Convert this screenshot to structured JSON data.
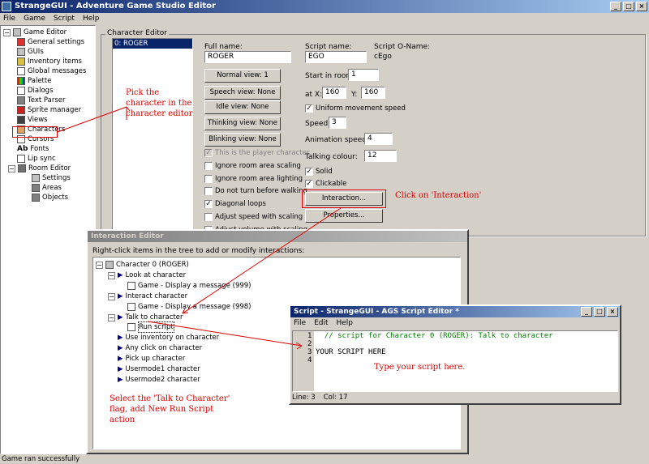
{
  "app": {
    "title": "StrangeGUI - Adventure Game Studio Editor",
    "window_buttons": [
      "_",
      "□",
      "×"
    ]
  },
  "menu": [
    "File",
    "Game",
    "Script",
    "Help"
  ],
  "tree": {
    "root": "Game Editor",
    "items": [
      "General settings",
      "GUIs",
      "Inventory items",
      "Global messages",
      "Palette",
      "Dialogs",
      "Text Parser",
      "Sprite manager",
      "Views",
      "Characters",
      "Cursors",
      "Fonts",
      "Lip sync",
      "Room Editor"
    ],
    "room_items": [
      "Settings",
      "Areas",
      "Objects"
    ]
  },
  "char_editor": {
    "group_title": "Character Editor",
    "list_items": [
      "0: ROGER"
    ],
    "full_name_label": "Full name:",
    "full_name": "ROGER",
    "script_name_label": "Script name:",
    "script_name": "EGO",
    "script_oname_label": "Script O-Name:",
    "script_oname": "cEgo",
    "start_room_label": "Start in room",
    "start_room": "1",
    "at_x_label": "at X:",
    "at_x": "160",
    "y_label": "Y:",
    "y": "160",
    "buttons": [
      "Normal view: 1",
      "Speech view: None",
      "Idle view: None",
      "Thinking view: None",
      "Blinking view: None"
    ],
    "uniform_label": "Uniform movement speed",
    "speed_label": "Speed:",
    "speed": "3",
    "anim_label": "Animation speed:",
    "anim": "4",
    "talk_colour_label": "Talking colour:",
    "talk_colour": "12",
    "solid_label": "Solid",
    "clickable_label": "Clickable",
    "interaction_btn": "Interaction...",
    "properties_btn": "Properties...",
    "checks": [
      "This is the player character",
      "Ignore room area scaling",
      "Ignore room area lighting",
      "Do not turn before walking",
      "Diagonal loops",
      "Adjust speed with scaling",
      "Adjust volume with scaling"
    ]
  },
  "annotations": {
    "pick": "Pick the character in the character editor",
    "click": "Click on 'Interaction'",
    "select": "Select the 'Talk to Character' flag, add New Run Script action",
    "type": "Type your script here."
  },
  "interaction_editor": {
    "title": "Interaction Editor",
    "hint": "Right-click items in the tree to add or modify interactions:",
    "root": "Character 0 (ROGER)",
    "events": [
      {
        "label": "Look at character",
        "child": "Game - Display a message (999)"
      },
      {
        "label": "Interact character",
        "child": "Game - Display a message (998)"
      },
      {
        "label": "Talk to character",
        "child": "Run script"
      },
      {
        "label": "Use inventory on character",
        "child": ""
      },
      {
        "label": "Any click on character",
        "child": ""
      },
      {
        "label": "Pick up character",
        "child": ""
      },
      {
        "label": "Usermode1 character",
        "child": ""
      },
      {
        "label": "Usermode2 character",
        "child": ""
      }
    ]
  },
  "script_editor": {
    "title": "Script - StrangeGUI - AGS Script Editor *",
    "menu": [
      "File",
      "Edit",
      "Help"
    ],
    "line_numbers": [
      "1",
      "2",
      "3",
      "4"
    ],
    "lines": [
      "  // script for Character 0 (ROGER): Talk to character",
      "",
      "YOUR SCRIPT HERE",
      ""
    ],
    "status_line": "Line: 3",
    "status_col": "Col: 17"
  },
  "status": "Game ran successfully"
}
